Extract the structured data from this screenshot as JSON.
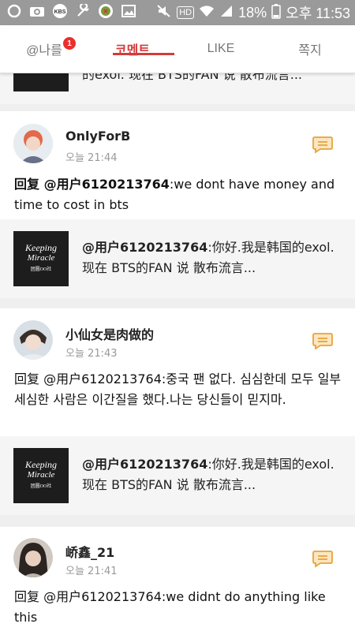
{
  "status_bar": {
    "battery": "18%",
    "time": "오후 11:53",
    "hd": "HD",
    "icons": [
      "circle-icon",
      "camera-icon",
      "app-icon",
      "wrench-icon",
      "app-icon-2",
      "image-icon",
      "mute-icon",
      "hd-icon",
      "wifi-icon",
      "signal-icon",
      "battery-icon"
    ]
  },
  "tabs": [
    {
      "label": "@나를",
      "badge": "1"
    },
    {
      "label": "코멘트",
      "active": true
    },
    {
      "label": "LIKE"
    },
    {
      "label": "쪽지"
    }
  ],
  "top_quote": {
    "text": "的exol. 现在 BTS的FAN 说 散布流言..."
  },
  "comments": [
    {
      "username": "OnlyForB",
      "time": "오늘 21:44",
      "mention": "回复 @用户6120213764",
      "text": ":we dont have money and time to cost in bts",
      "quote_mention": "@用户6120213764",
      "quote_text": ":你好.我是韩国的exol. 现在 BTS的FAN 说 散布流言..."
    },
    {
      "username": "小仙女是肉做的",
      "time": "오늘 21:43",
      "mention": "回复 @用户6120213764",
      "text": ":중국 팬 없다. 심심한데 모두 일부 세심한 사람은 이간질을 했다.나는 당신들이 믿지마.",
      "quote_mention": "@用户6120213764",
      "quote_text": ":你好.我是韩国的exol. 现在 BTS的FAN 说 散布流言..."
    },
    {
      "username": "峤鑫_21",
      "time": "오늘 21:41",
      "mention": "回复 @用户6120213764",
      "text": ":we didnt do anything like this"
    }
  ],
  "thumb": {
    "line1": "Keeping",
    "line2": "Miracle",
    "line3": "团圆OO社"
  },
  "colors": {
    "accent": "#d43b3b",
    "comment_icon": "#e8a33a",
    "status_bar": "#9a9a9a"
  }
}
